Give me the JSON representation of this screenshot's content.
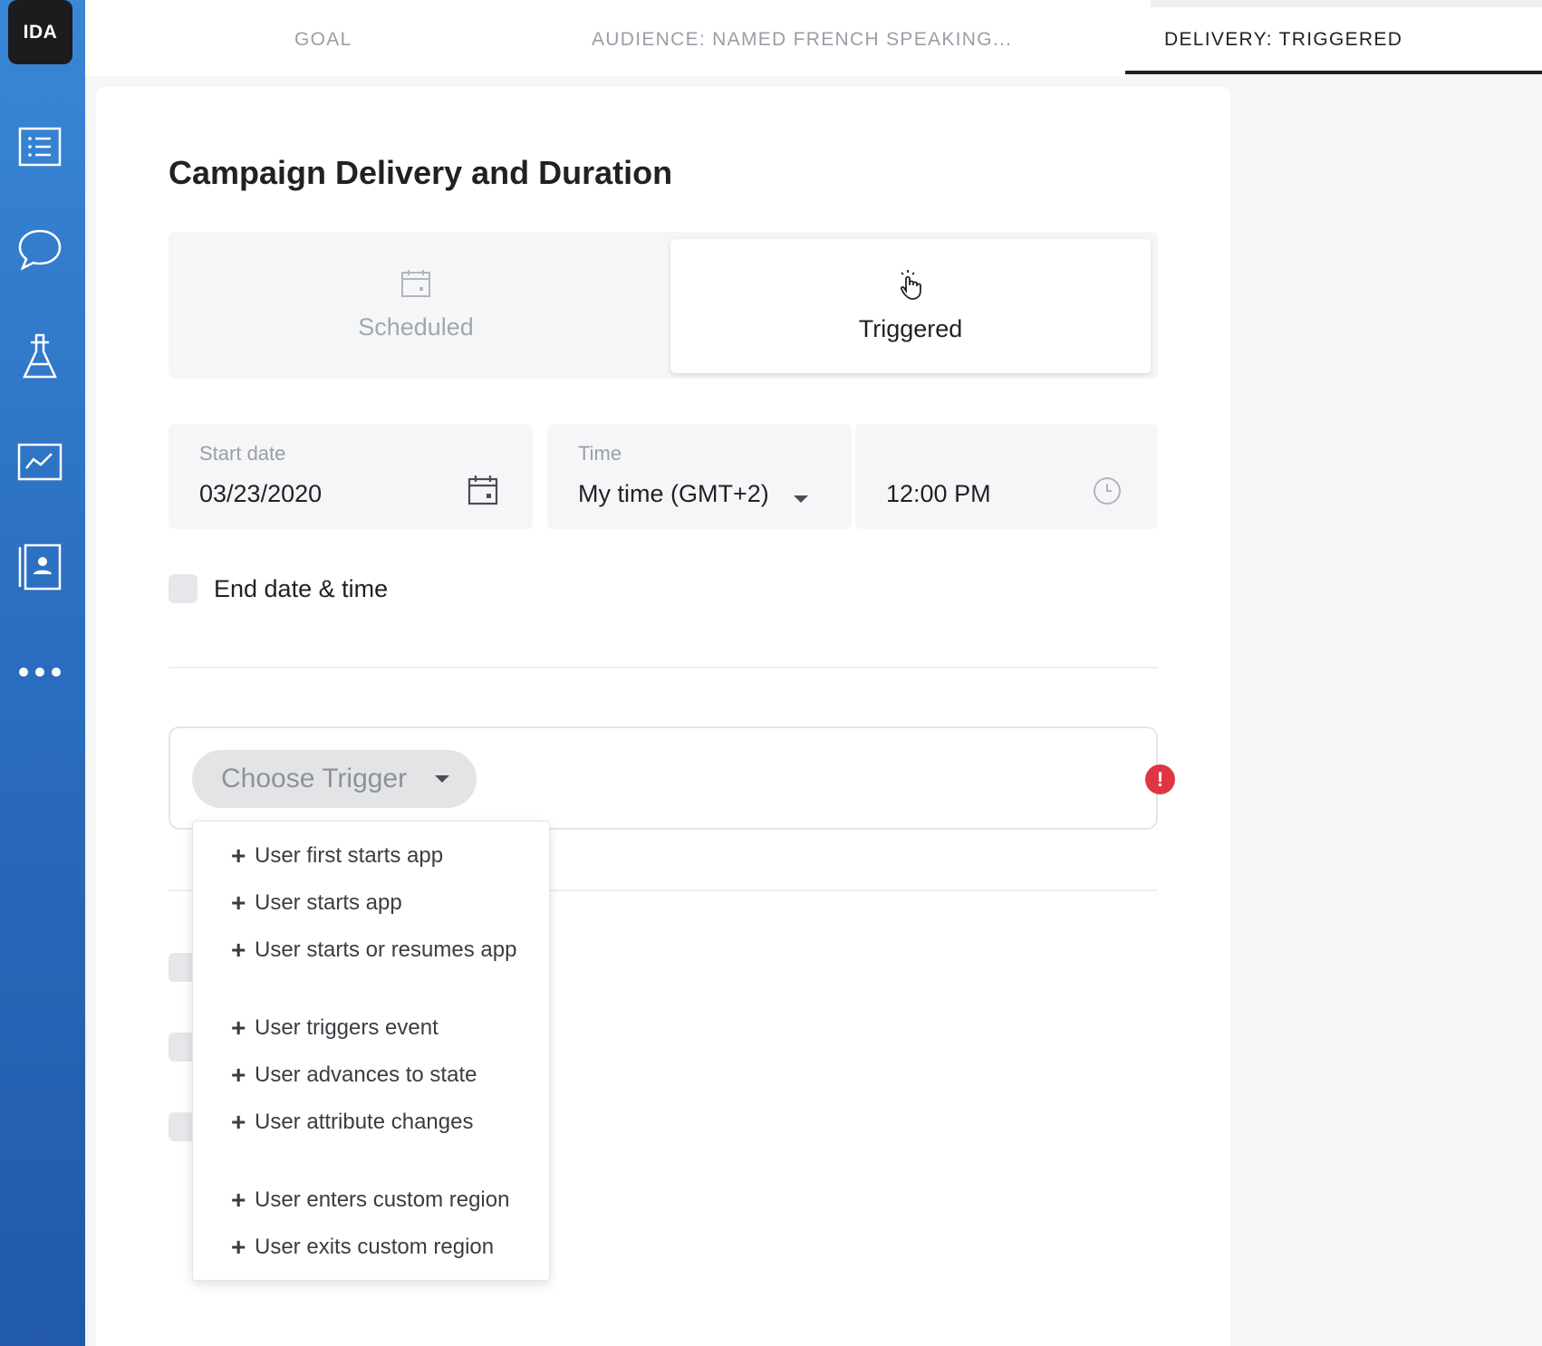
{
  "app": {
    "logo_text": "IDA"
  },
  "sidebar": {
    "items": [
      {
        "icon": "list-icon"
      },
      {
        "icon": "chat-bubble-icon"
      },
      {
        "icon": "flask-icon"
      },
      {
        "icon": "chart-icon"
      },
      {
        "icon": "contacts-icon"
      },
      {
        "icon": "more-icon"
      }
    ]
  },
  "tabs": [
    {
      "label": "GOAL",
      "active": false
    },
    {
      "label": "AUDIENCE: NAMED FRENCH SPEAKING...",
      "active": false
    },
    {
      "label": "DELIVERY: TRIGGERED",
      "active": true
    }
  ],
  "page": {
    "title": "Campaign Delivery and Duration"
  },
  "delivery_type": {
    "options": [
      {
        "label": "Scheduled",
        "icon": "calendar-icon",
        "selected": false
      },
      {
        "label": "Triggered",
        "icon": "tap-hand-icon",
        "selected": true
      }
    ]
  },
  "start_date": {
    "label": "Start date",
    "value": "03/23/2020"
  },
  "time_zone": {
    "label": "Time",
    "value": "My time (GMT+2)"
  },
  "time": {
    "value": "12:00 PM"
  },
  "end_date": {
    "label": "End date & time",
    "checked": false
  },
  "trigger": {
    "button_label": "Choose Trigger",
    "error_icon": "!",
    "options": [
      {
        "label": "User first starts app"
      },
      {
        "label": "User starts app"
      },
      {
        "label": "User starts or resumes app"
      },
      {
        "label": "User triggers event"
      },
      {
        "label": "User advances to state"
      },
      {
        "label": "User attribute changes"
      },
      {
        "label": "User enters custom region"
      },
      {
        "label": "User exits custom region"
      }
    ]
  },
  "colors": {
    "sidebar_top": "#3a87d6",
    "sidebar_bottom": "#2259aa",
    "error": "#e03543",
    "text_primary": "#1f2124",
    "text_muted": "#9a9ea5"
  }
}
